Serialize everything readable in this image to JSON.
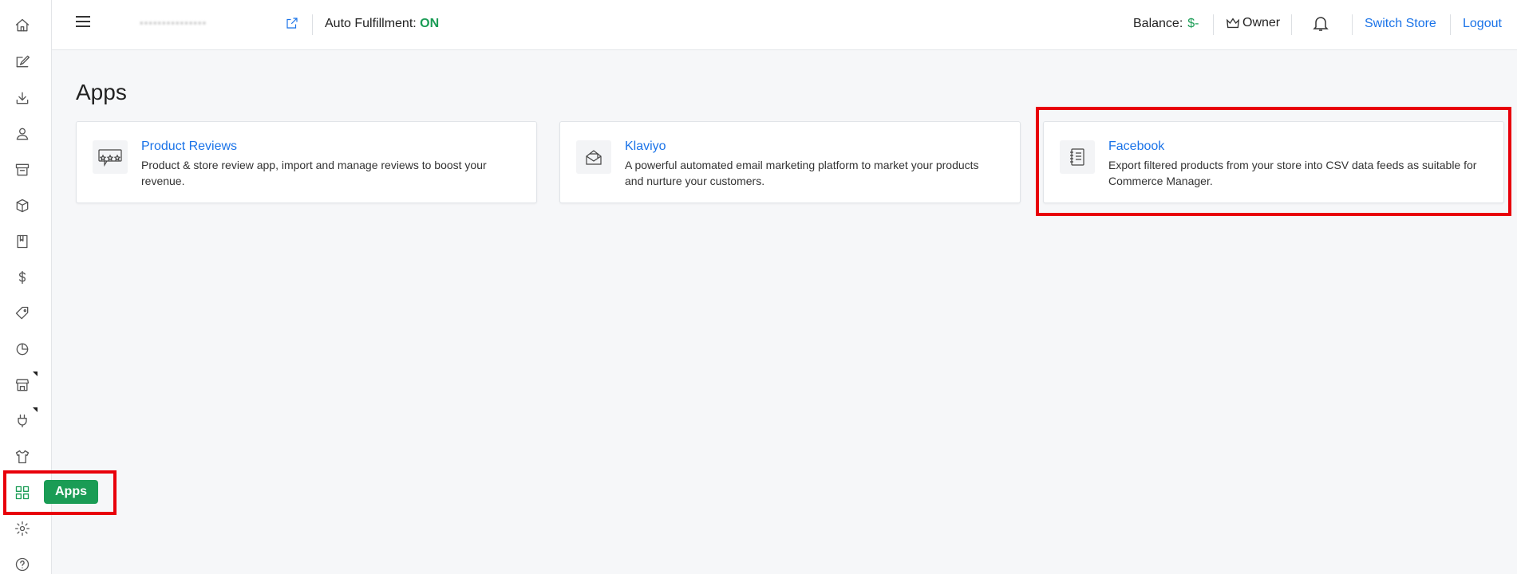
{
  "sidebar": {
    "items": [
      {
        "icon": "home-icon"
      },
      {
        "icon": "edit-icon"
      },
      {
        "icon": "download-icon"
      },
      {
        "icon": "user-icon"
      },
      {
        "icon": "archive-icon"
      },
      {
        "icon": "box-icon"
      },
      {
        "icon": "book-icon"
      },
      {
        "icon": "dollar-icon"
      },
      {
        "icon": "tag-icon"
      },
      {
        "icon": "pie-chart-icon"
      },
      {
        "icon": "storefront-icon"
      },
      {
        "icon": "plug-icon"
      },
      {
        "icon": "shirt-icon"
      },
      {
        "icon": "apps-grid-icon"
      },
      {
        "icon": "gear-icon"
      },
      {
        "icon": "help-icon"
      }
    ],
    "apps_tooltip": "Apps"
  },
  "topbar": {
    "auto_fulfillment_label": "Auto Fulfillment:",
    "auto_fulfillment_value": "ON",
    "balance_label": "Balance:",
    "balance_value": "$-",
    "owner_label": "Owner",
    "switch_store": "Switch Store",
    "logout": "Logout"
  },
  "page": {
    "title": "Apps"
  },
  "apps": [
    {
      "name": "Product Reviews",
      "description": "Product & store review app, import and manage reviews to boost your revenue.",
      "icon": "reviews-icon"
    },
    {
      "name": "Klaviyo",
      "description": "A powerful automated email marketing platform to market your products and nurture your customers.",
      "icon": "email-icon"
    },
    {
      "name": "Facebook",
      "description": "Export filtered products from your store into CSV data feeds as suitable for Commerce Manager.",
      "icon": "notebook-icon"
    }
  ],
  "colors": {
    "accent_green": "#1a9c55",
    "link_blue": "#1a73e8",
    "highlight_red": "#e8000b"
  }
}
